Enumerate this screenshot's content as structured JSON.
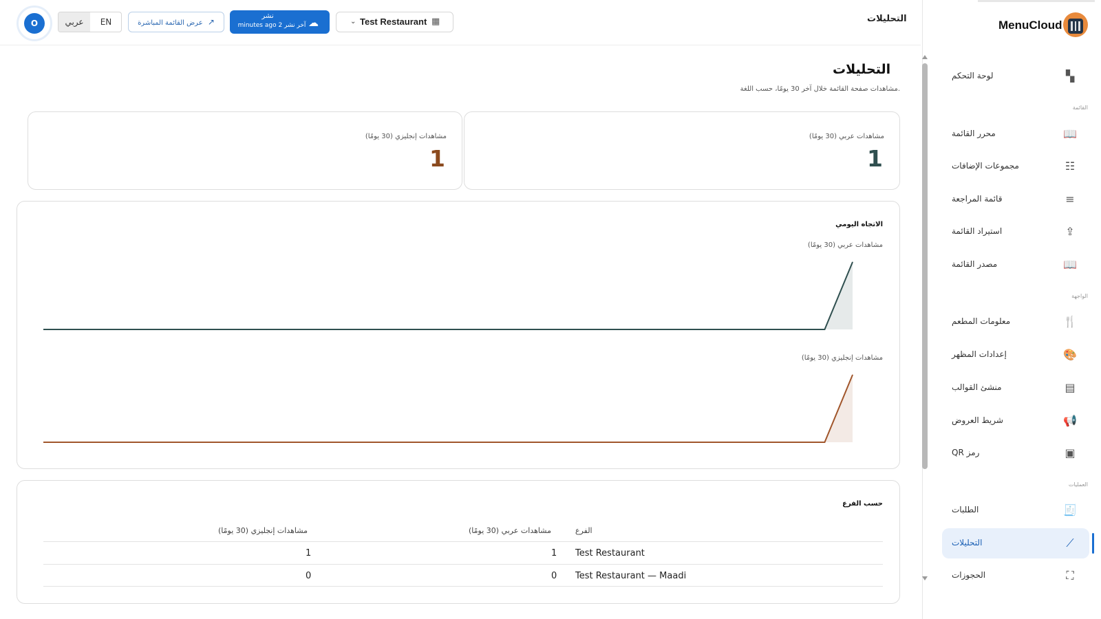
{
  "app": {
    "brand": "MenuCloud"
  },
  "header": {
    "title": "التحليلات",
    "avatar_initial": "O",
    "lang_en": "EN",
    "lang_ar": "عربي",
    "live_menu_label": "عرض القائمة المباشرة",
    "publish_label": "نشر",
    "publish_sub": "minutes ago 2 آخر نشر",
    "restaurant": "Test Restaurant"
  },
  "sidebar": {
    "items": [
      {
        "label": "لوحة التحكم",
        "icon": "dashboard-icon"
      },
      {
        "label": "محرر القائمة",
        "icon": "book-icon"
      },
      {
        "label": "مجموعات الإضافات",
        "icon": "sliders-icon"
      },
      {
        "label": "قائمة المراجعة",
        "icon": "checklist-icon"
      },
      {
        "label": "استيراد القائمة",
        "icon": "import-icon"
      },
      {
        "label": "مصدر القائمة",
        "icon": "book-icon"
      },
      {
        "label": "معلومات المطعم",
        "icon": "utensils-icon"
      },
      {
        "label": "إعدادات المظهر",
        "icon": "palette-icon"
      },
      {
        "label": "منشئ القوالب",
        "icon": "layout-icon"
      },
      {
        "label": "شريط العروض",
        "icon": "megaphone-icon"
      },
      {
        "label": "رمز QR",
        "icon": "qr-icon"
      },
      {
        "label": "الطلبات",
        "icon": "receipt-icon"
      },
      {
        "label": "التحليلات",
        "icon": "analytics-icon"
      },
      {
        "label": "الحجوزات",
        "icon": "reservation-icon"
      }
    ],
    "sections": [
      "القائمة",
      "الواجهة",
      "العمليات"
    ]
  },
  "main": {
    "title": "التحليلات",
    "subtitle": "مشاهدات صفحة القائمة خلال آخر 30 يومًا، حسب اللغة.",
    "kpis": [
      {
        "label": "مشاهدات عربي (30 يومًا)",
        "value": "1",
        "color": "#2f4f4f"
      },
      {
        "label": "مشاهدات إنجليزي (30 يومًا)",
        "value": "1",
        "color": "#8b4a1e"
      }
    ],
    "trend_title": "الاتجاه اليومي",
    "branch_title": "حسب الفرع",
    "table": {
      "headers": [
        "الفرع",
        "مشاهدات عربي (30 يومًا)",
        "مشاهدات إنجليزي (30 يومًا)"
      ],
      "rows": [
        [
          "Test Restaurant",
          "1",
          "1"
        ],
        [
          "Test Restaurant — Maadi",
          "0",
          "0"
        ]
      ]
    }
  },
  "chart_data": [
    {
      "type": "area",
      "title": "مشاهدات عربي (30 يومًا)",
      "x": [
        1,
        2,
        3,
        4,
        5,
        6,
        7,
        8,
        9,
        10,
        11,
        12,
        13,
        14,
        15,
        16,
        17,
        18,
        19,
        20,
        21,
        22,
        23,
        24,
        25,
        26,
        27,
        28,
        29,
        30
      ],
      "values": [
        0,
        0,
        0,
        0,
        0,
        0,
        0,
        0,
        0,
        0,
        0,
        0,
        0,
        0,
        0,
        0,
        0,
        0,
        0,
        0,
        0,
        0,
        0,
        0,
        0,
        0,
        0,
        0,
        0,
        1
      ],
      "color": "#2f4f4f",
      "ylim": [
        0,
        1
      ]
    },
    {
      "type": "area",
      "title": "مشاهدات إنجليزي (30 يومًا)",
      "x": [
        1,
        2,
        3,
        4,
        5,
        6,
        7,
        8,
        9,
        10,
        11,
        12,
        13,
        14,
        15,
        16,
        17,
        18,
        19,
        20,
        21,
        22,
        23,
        24,
        25,
        26,
        27,
        28,
        29,
        30
      ],
      "values": [
        0,
        0,
        0,
        0,
        0,
        0,
        0,
        0,
        0,
        0,
        0,
        0,
        0,
        0,
        0,
        0,
        0,
        0,
        0,
        0,
        0,
        0,
        0,
        0,
        0,
        0,
        0,
        0,
        0,
        1
      ],
      "color": "#a0552a",
      "ylim": [
        0,
        1
      ]
    }
  ]
}
